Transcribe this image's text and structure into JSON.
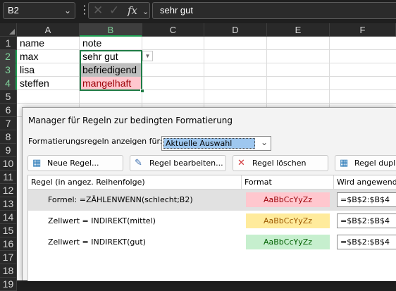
{
  "formula_bar": {
    "name_box": "B2",
    "formula": "sehr gut",
    "fx_label": "fx"
  },
  "columns": [
    "A",
    "B",
    "C",
    "D",
    "E",
    "F"
  ],
  "rows": [
    "1",
    "2",
    "3",
    "4",
    "5",
    "6",
    "7",
    "8",
    "9",
    "10",
    "11",
    "12",
    "13",
    "14",
    "15",
    "16",
    "17",
    "18",
    "19"
  ],
  "cells": {
    "a1": "name",
    "b1": "note",
    "a2": "max",
    "b2": "sehr gut",
    "a3": "lisa",
    "b3": "befriedigend",
    "a4": "steffen",
    "b4": "mangelhaft"
  },
  "dialog": {
    "title": "Manager für Regeln zur bedingten Formatierung",
    "show_rules_label": "Formatierungsregeln anzeigen für:",
    "show_rules_value": "Aktuelle Auswahl",
    "buttons": {
      "new": "Neue Regel...",
      "edit": "Regel bearbeiten...",
      "delete": "Regel löschen",
      "duplicate": "Regel dupli"
    },
    "headers": {
      "rule": "Regel (in angez. Reihenfolge)",
      "format": "Format",
      "applies": "Wird angewend"
    },
    "rules": [
      {
        "text": "Formel: =ZÄHLENWENN(schlecht;B2)",
        "preview": "AaBbCcYyZz",
        "applies_to": "=$B$2:$B$4",
        "bg": "#ffc7ce",
        "fg": "#9c0006"
      },
      {
        "text": "Zellwert = INDIREKT(mittel)",
        "preview": "AaBbCcYyZz",
        "applies_to": "=$B$2:$B$4",
        "bg": "#ffeb9c",
        "fg": "#9c5700"
      },
      {
        "text": "Zellwert = INDIREKT(gut)",
        "preview": "AaBbCcYyZz",
        "applies_to": "=$B$2:$B$4",
        "bg": "#c6efce",
        "fg": "#006100"
      }
    ]
  },
  "colors": {
    "selection_green": "#1e7b45",
    "header_dark": "#292929",
    "dialog_bg": "#f3f3f3"
  }
}
